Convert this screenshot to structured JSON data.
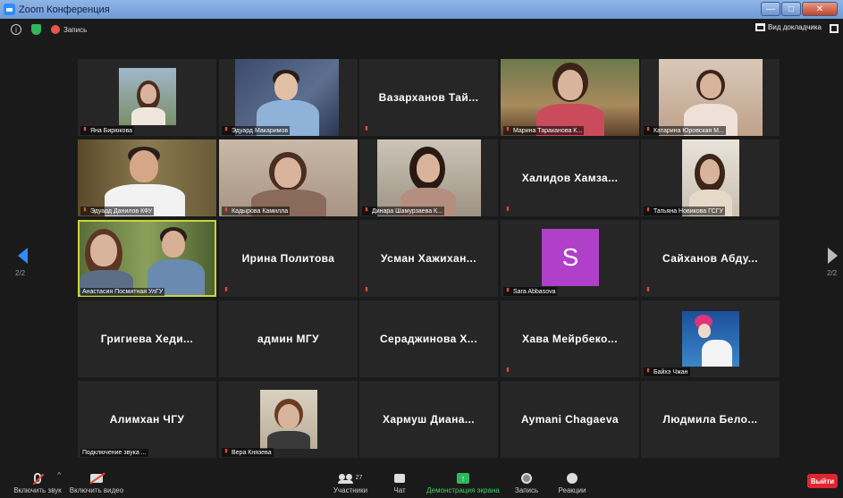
{
  "window": {
    "title": "Zoom Конференция",
    "min": "—",
    "max": "□",
    "close": "✕"
  },
  "topbar": {
    "info": "i",
    "recording_label": "Запись",
    "speaker_view": "Вид докладчика"
  },
  "pager": {
    "left_label": "2/2",
    "right_label": "2/2"
  },
  "tiles": [
    {
      "name": "Яна Бирюкова"
    },
    {
      "name": "Эдуард Макаримов"
    },
    {
      "name": "Вазарханов Тай..."
    },
    {
      "name": "Марина Тараканова К..."
    },
    {
      "name": "Катарина Юровская М..."
    },
    {
      "name": "Эдуард Данилов КФУ"
    },
    {
      "name": "Кадырова Камилла"
    },
    {
      "name": "Динара Шамурзаева К..."
    },
    {
      "name": "Халидов Хамза..."
    },
    {
      "name": "Татьяна Новикова ГСГУ"
    },
    {
      "name": "Анастасия Посмитная УлГУ"
    },
    {
      "name": "Ирина Политова"
    },
    {
      "name": "Усман Хажихан..."
    },
    {
      "name": "Sara Abbasova",
      "initial": "S"
    },
    {
      "name": "Сайханов Абду..."
    },
    {
      "name": "Григиева Хеди..."
    },
    {
      "name": "админ МГУ"
    },
    {
      "name": "Сераджинова Х..."
    },
    {
      "name": "Хава Мейрбеко..."
    },
    {
      "name": "Байхэ Чжан"
    },
    {
      "name": "Алимхан ЧГУ",
      "status": "Подключение звука ..."
    },
    {
      "name": "Вера Князева"
    },
    {
      "name": "Хармуш Диана..."
    },
    {
      "name": "Aymani Chagaeva"
    },
    {
      "name": "Людмила Бело..."
    }
  ],
  "toolbar": {
    "audio": "Включить звук",
    "video": "Включить видео",
    "participants": "Участники",
    "participants_count": "27",
    "chat": "Чат",
    "share": "Демонстрация экрана",
    "record": "Запись",
    "reactions": "Реакции",
    "leave": "Выйти",
    "chevron": "^",
    "share_arrow": "↑"
  },
  "colors": {
    "accent": "#2d8cff",
    "active_border": "#c7d63a",
    "share_green": "#2eb85c",
    "leave_red": "#e0252f",
    "sara_avatar": "#b03fc9"
  }
}
